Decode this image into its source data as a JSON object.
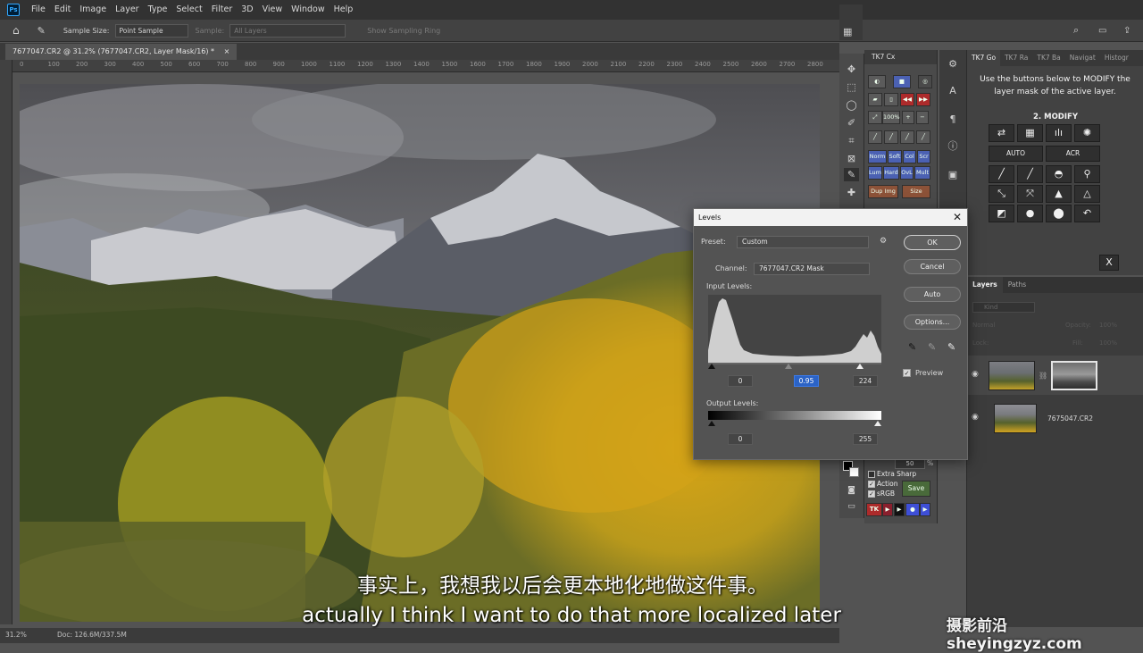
{
  "app": {
    "logo": "Ps"
  },
  "menu": [
    "File",
    "Edit",
    "Image",
    "Layer",
    "Type",
    "Select",
    "Filter",
    "3D",
    "View",
    "Window",
    "Help"
  ],
  "options_bar": {
    "sample_size_label": "Sample Size:",
    "sample_size_value": "Point Sample",
    "sample_label": "Sample:",
    "sample_value": "All Layers",
    "show_ring_label": "Show Sampling Ring"
  },
  "document_tab": {
    "title": "7677047.CR2 @ 31.2% (7677047.CR2, Layer Mask/16) *",
    "close": "×"
  },
  "ruler_ticks": [
    "0",
    "100",
    "200",
    "300",
    "400",
    "500",
    "600",
    "700",
    "800",
    "900",
    "1000",
    "1100",
    "1200",
    "1300",
    "1400",
    "1500",
    "1600",
    "1700",
    "1800",
    "1900",
    "2000",
    "2100",
    "2200",
    "2300",
    "2400",
    "2500",
    "2600",
    "2700",
    "2800"
  ],
  "status_bar": {
    "zoom": "31.2%",
    "doc": "Doc: 126.6M/337.5M"
  },
  "tk7cx": {
    "title": "TK7 Cx",
    "blend_buttons": [
      "Norm",
      "Soft",
      "Col",
      "Scr",
      "Lum",
      "Hard",
      "OvL",
      "Mult"
    ],
    "dup_img": "Dup Img",
    "size": "Size",
    "zoom": "100%",
    "percent_value": "50",
    "percent_unit": "%",
    "checks": [
      {
        "label": "Extra Sharp",
        "checked": false
      },
      {
        "label": "Action",
        "checked": true
      },
      {
        "label": "sRGB",
        "checked": true
      }
    ],
    "save": "Save",
    "tk": "TK"
  },
  "tk7go": {
    "tabs": [
      "TK7 Go",
      "TK7 Ra",
      "TK7 Ba",
      "Navigat",
      "Histogr"
    ],
    "instructions": "Use the buttons below to MODIFY the layer mask of the active layer.",
    "section": "2. MODIFY",
    "auto": "AUTO",
    "acr": "ACR",
    "close": "X"
  },
  "layers_panel": {
    "tabs": [
      "Layers",
      "Paths"
    ],
    "search_placeholder": "Kind",
    "blend_mode": "Normal",
    "opacity_label": "Opacity:",
    "opacity_value": "100%",
    "lock_label": "Lock:",
    "fill_label": "Fill:",
    "fill_value": "100%",
    "layers": [
      {
        "name": "",
        "has_mask": true,
        "visible": true,
        "selected": true
      },
      {
        "name": "7675047.CR2",
        "has_mask": false,
        "visible": true,
        "selected": false
      }
    ]
  },
  "levels_dialog": {
    "title": "Levels",
    "preset_label": "Preset:",
    "preset_value": "Custom",
    "channel_label": "Channel:",
    "channel_value": "7677047.CR2 Mask",
    "input_levels_label": "Input Levels:",
    "input_black": "0",
    "input_gamma": "0.95",
    "input_white": "224",
    "output_levels_label": "Output Levels:",
    "output_black": "0",
    "output_white": "255",
    "buttons": {
      "ok": "OK",
      "cancel": "Cancel",
      "auto": "Auto",
      "options": "Options..."
    },
    "preview_label": "Preview",
    "preview_checked": true
  },
  "subtitles": {
    "chinese": "事实上，我想我以后会更本地化地做这件事。",
    "english": "actually I think I want to do that more localized later"
  },
  "watermark": "摄影前沿 sheyingzyz.com"
}
